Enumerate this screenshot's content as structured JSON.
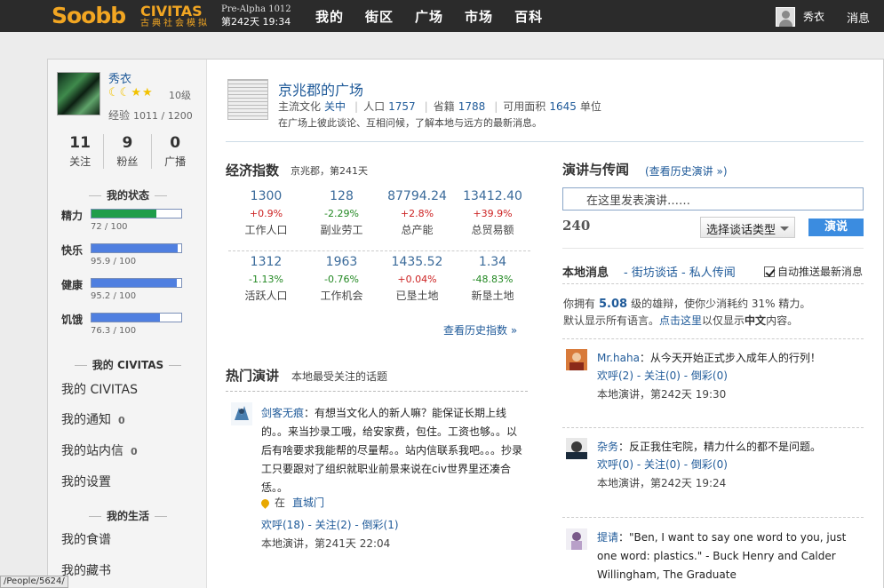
{
  "topbar": {
    "logo": "Soobb",
    "civ_title": "CIVITAS",
    "civ_sub": "古典社会模拟",
    "version": "Pre-Alpha 1012",
    "game_time": "第242天 19:34",
    "nav": [
      "我的",
      "街区",
      "广场",
      "市场",
      "百科"
    ],
    "user": "秀衣",
    "messages": "消息"
  },
  "profile": {
    "name": "秀衣",
    "level": "10级",
    "exp_label": "经验",
    "exp_value": "1011 / 1200",
    "counts": [
      {
        "n": "11",
        "label": "关注"
      },
      {
        "n": "9",
        "label": "粉丝"
      },
      {
        "n": "0",
        "label": "广播"
      }
    ]
  },
  "status": {
    "title": "我的状态",
    "items": [
      {
        "label": "精力",
        "value": "72 / 100",
        "percent": 72,
        "color": "#1f9d4a"
      },
      {
        "label": "快乐",
        "value": "95.9 / 100",
        "percent": 95.9,
        "color": "#4f7fe0"
      },
      {
        "label": "健康",
        "value": "95.2 / 100",
        "percent": 95.2,
        "color": "#4f7fe0"
      },
      {
        "label": "饥饿",
        "value": "76.3 / 100",
        "percent": 76.3,
        "color": "#4f7fe0"
      }
    ]
  },
  "my_civitas": {
    "title": "我的 CIVITAS",
    "items": [
      {
        "label": "我的 CIVITAS",
        "badge": ""
      },
      {
        "label": "我的通知",
        "badge": "0"
      },
      {
        "label": "我的站内信",
        "badge": "0"
      },
      {
        "label": "我的设置",
        "badge": ""
      }
    ]
  },
  "my_life": {
    "title": "我的生活",
    "items": [
      "我的食谱",
      "我的藏书"
    ]
  },
  "plaza": {
    "title": "京兆郡的广场",
    "culture_label": "主流文化",
    "culture_value": "关中",
    "pop_label": "人口",
    "pop_value": "1757",
    "reg_label": "省籍",
    "reg_value": "1788",
    "area_label": "可用面积",
    "area_value": "1645",
    "area_unit": "单位",
    "desc": "在广场上彼此谈论、互相问候，了解本地与远方的最新消息。"
  },
  "economy": {
    "title": "经济指数",
    "subtitle": "京兆郡，第241天",
    "rows": [
      [
        {
          "num": "1300",
          "chg": "+0.9%",
          "dir": "up",
          "name": "工作人口"
        },
        {
          "num": "128",
          "chg": "-2.29%",
          "dir": "down",
          "name": "副业劳工"
        },
        {
          "num": "87794.24",
          "chg": "+2.8%",
          "dir": "up",
          "name": "总产能"
        },
        {
          "num": "13412.40",
          "chg": "+39.9%",
          "dir": "up",
          "name": "总贸易额"
        }
      ],
      [
        {
          "num": "1312",
          "chg": "-1.13%",
          "dir": "down",
          "name": "活跃人口"
        },
        {
          "num": "1963",
          "chg": "-0.76%",
          "dir": "down",
          "name": "工作机会"
        },
        {
          "num": "1435.52",
          "chg": "+0.04%",
          "dir": "up",
          "name": "已垦土地"
        },
        {
          "num": "1.34",
          "chg": "-48.83%",
          "dir": "down",
          "name": "新垦土地"
        }
      ]
    ],
    "history_link": "查看历史指数 »"
  },
  "hot": {
    "title": "热门演讲",
    "subtitle": "本地最受关注的话题",
    "speech": {
      "who": "剑客无痕",
      "text": "：有想当文化人的新人嘛？能保证长期上线的。。来当抄录工哦，给安家费，包住。工资也够。。以后有啥要求我能帮的尽量帮。。站内信联系我吧。。。抄录工只要跟对了组织就职业前景来说在civ世界里还凑合恁。。",
      "loc_prefix": "在",
      "loc": "直城门",
      "actions": "欢呼(18) - 关注(2) - 倒彩(1)",
      "meta": "本地演讲，第241天  22:04"
    }
  },
  "speak": {
    "title": "演讲与传闻",
    "history": "(查看历史演讲 »)",
    "placeholder": "在这里发表演讲……",
    "counter": "240",
    "select": "选择谈话类型",
    "button": "演说"
  },
  "local": {
    "title": "本地消息",
    "tabs": [
      "- 街坊谈话",
      "- 私人传闻"
    ],
    "autopush": "自动推送最新消息",
    "elo_a": "你拥有",
    "elo_b": "5.08",
    "elo_c": "级的雄辩，使你少消耗约 31% 精力。",
    "lang_a": "默认显示所有语言。",
    "lang_b": "点击这里",
    "lang_c": "以仅显示",
    "lang_d": "中文",
    "lang_e": "内容。",
    "messages": [
      {
        "who": "Mr.haha",
        "text": "：从今天开始正式步入成年人的行列！",
        "actions": "欢呼(2) - 关注(0) - 倒彩(0)",
        "meta": "本地演讲，第242天  19:30"
      },
      {
        "who": "杂务",
        "text": "：反正我住宅院，精力什么的都不是问题。",
        "actions": "欢呼(0) - 关注(0) - 倒彩(0)",
        "meta": "本地演讲，第242天  19:24"
      },
      {
        "who": "提请",
        "text": "：\"Ben, I want to say one word to you, just one word: plastics.\" - Buck Henry and Calder Willingham, The Graduate",
        "actions": "",
        "meta": ""
      }
    ]
  },
  "statusbar": {
    "url": "/People/5624/"
  }
}
